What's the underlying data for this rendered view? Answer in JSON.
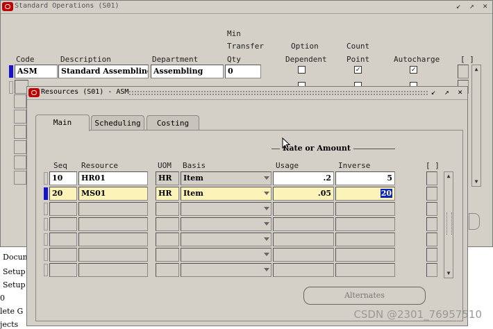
{
  "background_texts": [
    "Docum",
    "Setup",
    "Setup",
    "0",
    "lete G",
    "jects"
  ],
  "back_window": {
    "title": "Standard Operations (S01)",
    "window_buttons": "↙ ↗ ✕",
    "headers": {
      "code": "Code",
      "description": "Description",
      "department": "Department",
      "min_transfer_1": "Min",
      "min_transfer_2": "Transfer",
      "min_transfer_3": "Qty",
      "option_dependent_1": "Option",
      "option_dependent_2": "Dependent",
      "count_point_1": "Count",
      "count_point_2": "Point",
      "autocharge": "Autocharge",
      "brackets": "[ ]"
    },
    "row": {
      "code": "ASM",
      "description": "Standard Assembling",
      "department": "Assembling",
      "min_transfer_qty": "0",
      "option_dependent": false,
      "count_point": true,
      "autocharge": true
    }
  },
  "front_window": {
    "title": "Resources (S01) - ASM",
    "window_buttons": "↙ ↗ ✕",
    "tabs": [
      {
        "label": "Main",
        "active": true
      },
      {
        "label": "Scheduling",
        "active": false
      },
      {
        "label": "Costing",
        "active": false
      }
    ],
    "rate_group_label": "Rate or Amount",
    "headers": {
      "seq": "Seq",
      "resource": "Resource",
      "uom": "UOM",
      "basis": "Basis",
      "usage": "Usage",
      "inverse": "Inverse",
      "brackets": "[ ]"
    },
    "rows": [
      {
        "seq": "10",
        "resource": "HR01",
        "uom": "HR",
        "basis": "Item",
        "usage": ".2",
        "inverse": "5"
      },
      {
        "seq": "20",
        "resource": "MS01",
        "uom": "HR",
        "basis": "Item",
        "usage": ".05",
        "inverse": "20"
      }
    ],
    "alternates_button": "Alternates"
  },
  "watermark": "CSDN @2301_76957510",
  "colors": {
    "window_bg": "#d4d0c8",
    "current_row": "#fbf3b8",
    "selection": "#0a24b8",
    "oracle_logo": "#c00000"
  }
}
